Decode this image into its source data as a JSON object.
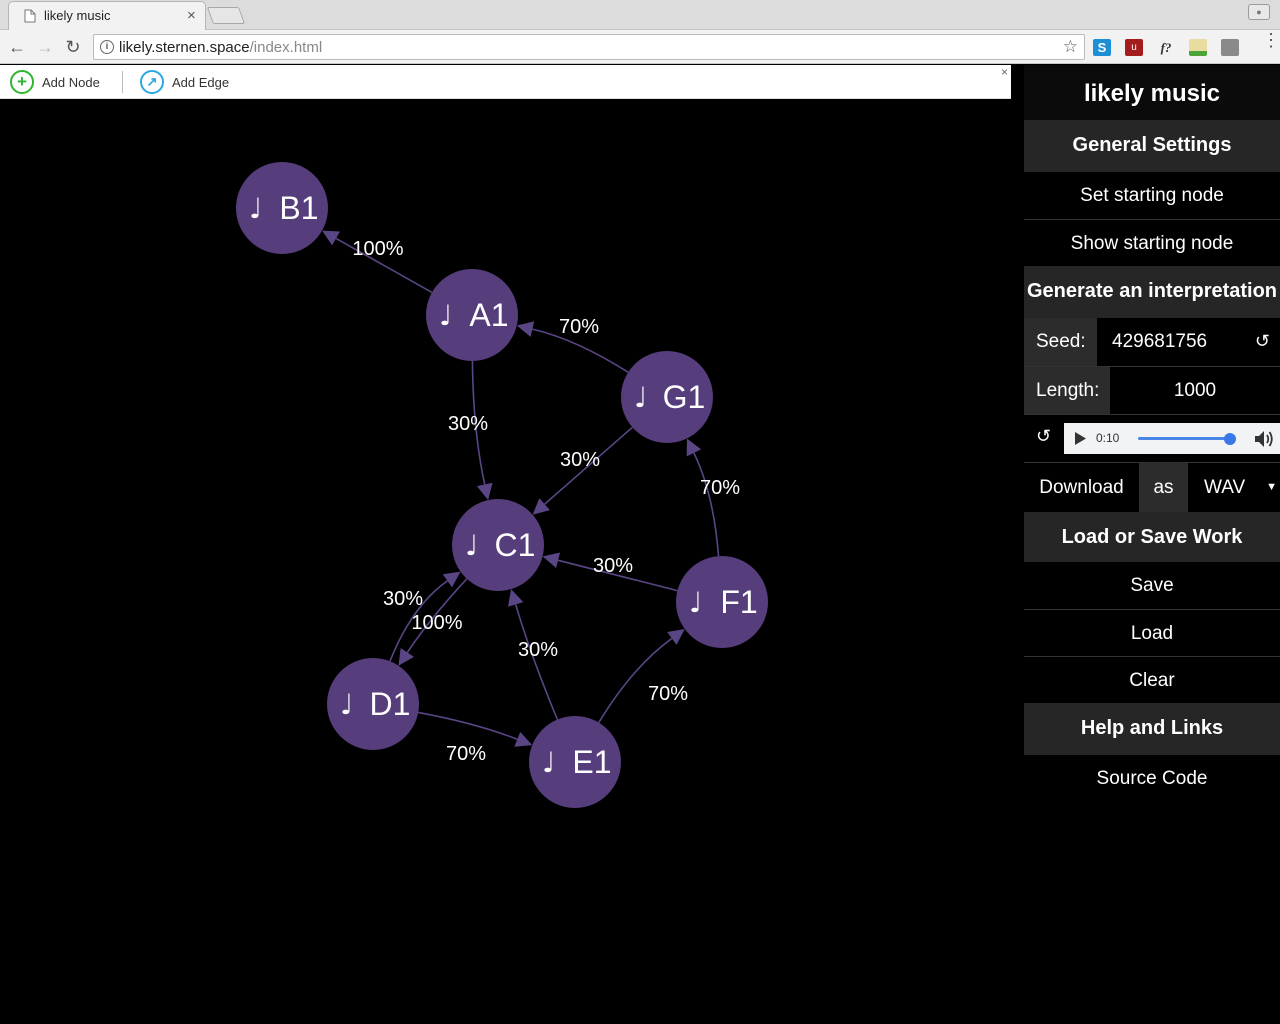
{
  "browser": {
    "tab_title": "likely music",
    "tab_close": "×",
    "url_host": "likely.sternen.space",
    "url_path": "/index.html"
  },
  "manipulation": {
    "add_node": "Add Node",
    "add_edge": "Add Edge",
    "close": "×"
  },
  "colors": {
    "node": "#563d7c",
    "edge": "#5a4585",
    "background": "#000000",
    "add_node_icon": "#2fb52f",
    "add_edge_icon": "#29a8e0"
  },
  "graph": {
    "note_glyph": "♩",
    "nodes": [
      {
        "id": "B1",
        "label": "B1"
      },
      {
        "id": "A1",
        "label": "A1"
      },
      {
        "id": "G1",
        "label": "G1"
      },
      {
        "id": "C1",
        "label": "C1"
      },
      {
        "id": "F1",
        "label": "F1"
      },
      {
        "id": "D1",
        "label": "D1"
      },
      {
        "id": "E1",
        "label": "E1"
      }
    ],
    "edges": [
      {
        "from": "A1",
        "to": "B1",
        "label": "100%"
      },
      {
        "from": "G1",
        "to": "A1",
        "label": "70%"
      },
      {
        "from": "A1",
        "to": "C1",
        "label": "30%"
      },
      {
        "from": "G1",
        "to": "C1",
        "label": "30%"
      },
      {
        "from": "F1",
        "to": "G1",
        "label": "70%"
      },
      {
        "from": "F1",
        "to": "C1",
        "label": "30%"
      },
      {
        "from": "D1",
        "to": "C1",
        "label": "30%"
      },
      {
        "from": "C1",
        "to": "D1",
        "label": "100%"
      },
      {
        "from": "E1",
        "to": "C1",
        "label": "30%"
      },
      {
        "from": "E1",
        "to": "F1",
        "label": "70%"
      },
      {
        "from": "D1",
        "to": "E1",
        "label": "70%"
      }
    ]
  },
  "sidebar": {
    "title": "likely music",
    "general_settings": "General Settings",
    "set_starting_node": "Set starting node",
    "show_starting_node": "Show starting node",
    "generate": "Generate an interpretation",
    "seed_label": "Seed:",
    "seed_value": "429681756",
    "seed_reload": "↺",
    "length_label": "Length:",
    "length_value": "1000",
    "audio_reload": "↺",
    "audio_time": "0:10",
    "audio_volume": 1.0,
    "download": "Download",
    "as": "as",
    "format": "WAV",
    "load_save": "Load or Save Work",
    "save": "Save",
    "load": "Load",
    "clear": "Clear",
    "help": "Help and Links",
    "source": "Source Code"
  }
}
